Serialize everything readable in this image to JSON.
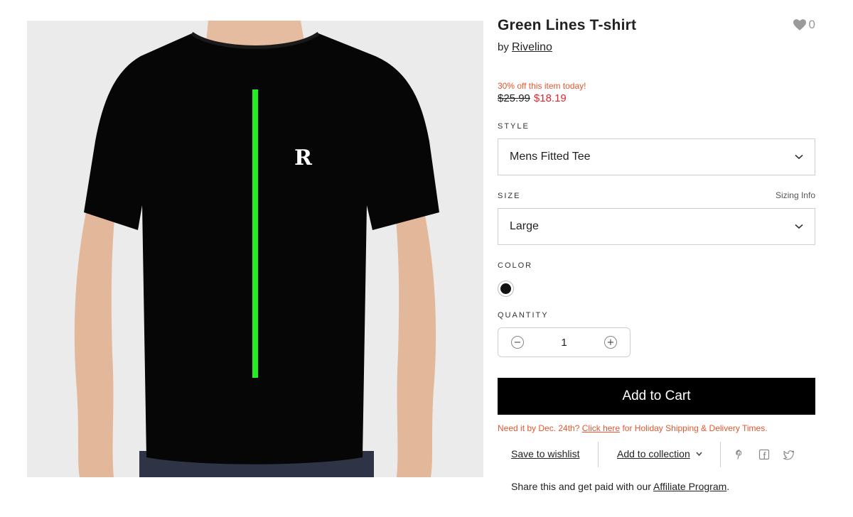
{
  "product": {
    "title": "Green Lines T-shirt",
    "by_prefix": "by",
    "artist": "Rivelino",
    "like_count": "0",
    "shirt_logo": "R",
    "colors": {
      "shirt": "#000000",
      "stripe": "#22ee22",
      "background": "#ebebeb"
    }
  },
  "pricing": {
    "promo": "30% off this item today!",
    "original_price": "$25.99",
    "sale_price": "$18.19"
  },
  "style": {
    "label": "STYLE",
    "value": "Mens Fitted Tee"
  },
  "size": {
    "label": "SIZE",
    "value": "Large",
    "sizing_info": "Sizing Info"
  },
  "color": {
    "label": "COLOR",
    "selected": "#111111"
  },
  "quantity": {
    "label": "QUANTITY",
    "value": "1",
    "minus": "−",
    "plus": "+"
  },
  "cart": {
    "button_label": "Add to Cart"
  },
  "holiday": {
    "prefix": "Need it by Dec. 24th?",
    "link": "Click here",
    "suffix": "for Holiday Shipping & Delivery Times."
  },
  "actions": {
    "wishlist": "Save to wishlist",
    "collection": "Add to collection",
    "social": [
      "pinterest-icon",
      "facebook-icon",
      "twitter-icon"
    ]
  },
  "affiliate": {
    "prefix": "Share this and get paid with our",
    "link": "Affiliate Program",
    "suffix": "."
  },
  "theme": {
    "accent_red": "#e4572e",
    "price_red": "#e0262d",
    "button_black": "#000000"
  }
}
